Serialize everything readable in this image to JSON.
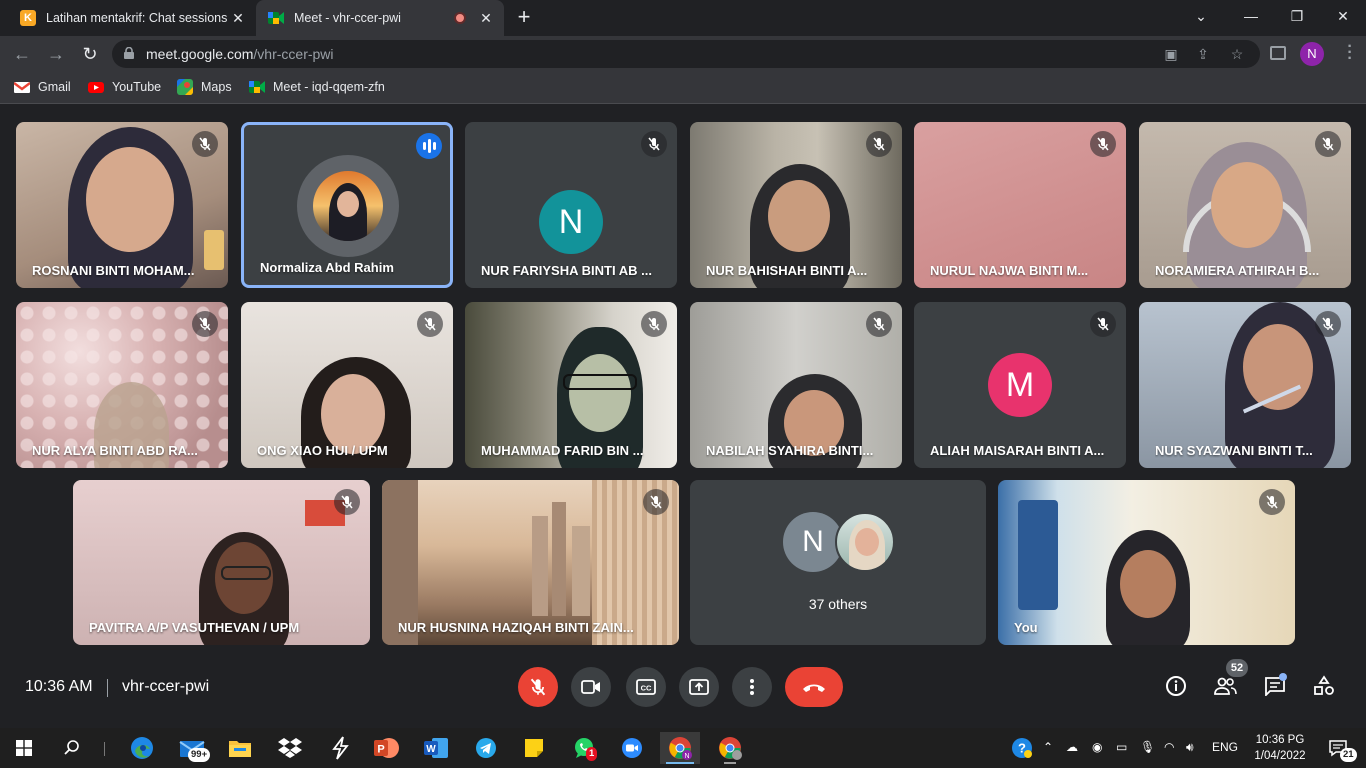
{
  "browser": {
    "tabs": [
      {
        "title": "Latihan mentakrif: Chat sessions",
        "favicon_letter": "K",
        "favicon_color": "#f9a825"
      },
      {
        "title": "Meet - vhr-ccer-pwi",
        "active": true
      }
    ],
    "url_host": "meet.google.com",
    "url_path": "/vhr-ccer-pwi",
    "profile_initial": "N",
    "bookmarks": [
      {
        "label": "Gmail",
        "icon": "gmail-icon"
      },
      {
        "label": "YouTube",
        "icon": "youtube-icon"
      },
      {
        "label": "Maps",
        "icon": "maps-icon"
      },
      {
        "label": "Meet - iqd-qqem-zfn",
        "icon": "meet-icon"
      }
    ]
  },
  "meet": {
    "participants": [
      {
        "name": "ROSNANI BINTI MOHAM...",
        "muted": true
      },
      {
        "name": "Normaliza Abd Rahim",
        "speaking": true
      },
      {
        "name": "NUR FARIYSHA BINTI AB ...",
        "muted": true,
        "initial": "N",
        "avatar_color": "#12939a"
      },
      {
        "name": "NUR BAHISHAH BINTI A...",
        "muted": true
      },
      {
        "name": "NURUL NAJWA BINTI M...",
        "muted": true
      },
      {
        "name": "NORAMIERA ATHIRAH B...",
        "muted": true
      },
      {
        "name": "NUR ALYA BINTI ABD RA...",
        "muted": true
      },
      {
        "name": "ONG XIAO HUI / UPM",
        "muted": true
      },
      {
        "name": "MUHAMMAD FARID BIN ...",
        "muted": true
      },
      {
        "name": "NABILAH SYAHIRA BINTI...",
        "muted": true
      },
      {
        "name": "ALIAH MAISARAH BINTI A...",
        "muted": true,
        "initial": "M",
        "avatar_color": "#e8336d"
      },
      {
        "name": "NUR SYAZWANI BINTI T...",
        "muted": true
      },
      {
        "name": "PAVITRA A/P VASUTHEVAN / UPM",
        "muted": true
      },
      {
        "name": "NUR HUSNINA HAZIQAH BINTI ZAIN...",
        "muted": true
      },
      {
        "name": "You",
        "muted": true
      }
    ],
    "others": {
      "label": "37 others",
      "initial": "N"
    },
    "time": "10:36 AM",
    "meeting_code": "vhr-ccer-pwi",
    "participant_count": "52"
  },
  "taskbar": {
    "mail_badge": "99+",
    "whatsapp_badge": "1",
    "language": "ENG",
    "time": "10:36 PG",
    "date": "1/04/2022",
    "notifications": "21"
  }
}
